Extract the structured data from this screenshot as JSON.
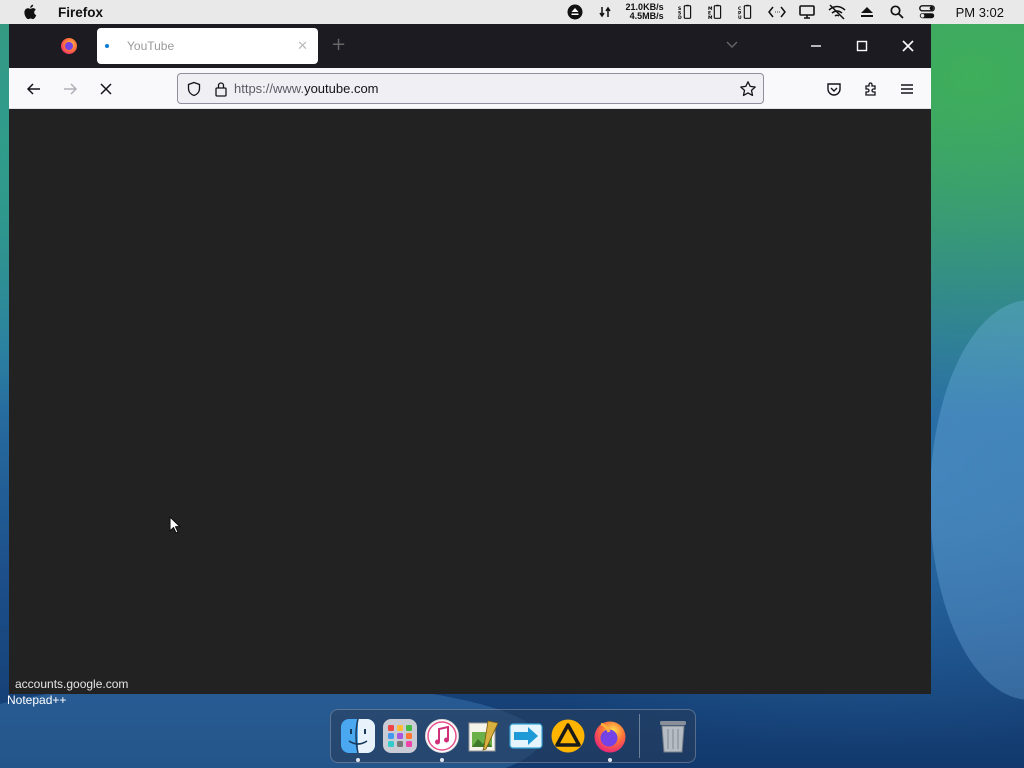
{
  "menubar": {
    "app_name": "Firefox",
    "net_up": "21.0KB/s",
    "net_down": "4.5MB/s",
    "clock": "PM 3:02"
  },
  "browser": {
    "tab": {
      "title": "YouTube"
    },
    "url": {
      "prefix": "https://www.",
      "host": "youtube.com"
    },
    "status_link": "accounts.google.com"
  },
  "desktop": {
    "label": "Notepad++"
  },
  "dock": {
    "items": [
      {
        "icon": "finder-icon",
        "running": true
      },
      {
        "icon": "launchpad-icon",
        "running": false
      },
      {
        "icon": "itunes-icon",
        "running": true
      },
      {
        "icon": "image-editor-icon",
        "running": false
      },
      {
        "icon": "migration-assistant-icon",
        "running": false
      },
      {
        "icon": "aimp-player-icon",
        "running": false
      },
      {
        "icon": "firefox-icon",
        "running": true
      }
    ],
    "trash_icon": "trash-icon"
  },
  "colors": {
    "content_bg": "#222222",
    "window_chrome": "#1c1b22",
    "toolbar_bg": "#f9f9fb",
    "loading_dot": "#0b7dd6"
  }
}
